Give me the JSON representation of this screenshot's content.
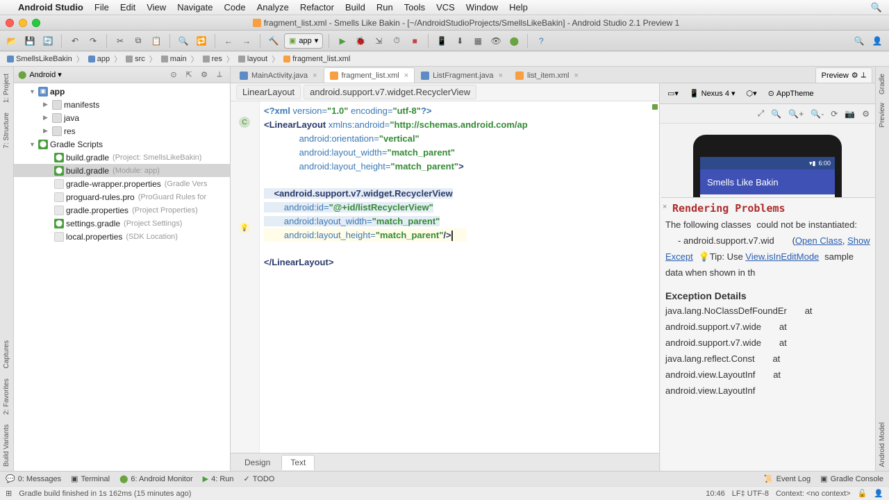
{
  "menubar": {
    "app": "Android Studio",
    "items": [
      "File",
      "Edit",
      "View",
      "Navigate",
      "Code",
      "Analyze",
      "Refactor",
      "Build",
      "Run",
      "Tools",
      "VCS",
      "Window",
      "Help"
    ]
  },
  "window_title": "fragment_list.xml - Smells Like Bakin - [~/AndroidStudioProjects/SmellsLikeBakin] - Android Studio 2.1 Preview 1",
  "breadcrumbs": [
    "SmellsLikeBakin",
    "app",
    "src",
    "main",
    "res",
    "layout",
    "fragment_list.xml"
  ],
  "run_config": "app",
  "project": {
    "view": "Android",
    "app": "app",
    "folders": [
      "manifests",
      "java",
      "res"
    ],
    "gradle_scripts": "Gradle Scripts",
    "items": [
      {
        "n": "build.gradle",
        "h": "(Project: SmellsLikeBakin)"
      },
      {
        "n": "build.gradle",
        "h": "(Module: app)",
        "sel": true
      },
      {
        "n": "gradle-wrapper.properties",
        "h": "(Gradle Vers"
      },
      {
        "n": "proguard-rules.pro",
        "h": "(ProGuard Rules for"
      },
      {
        "n": "gradle.properties",
        "h": "(Project Properties)"
      },
      {
        "n": "settings.gradle",
        "h": "(Project Settings)"
      },
      {
        "n": "local.properties",
        "h": "(SDK Location)"
      }
    ]
  },
  "tabs": [
    {
      "n": "MainActivity.java",
      "t": "java"
    },
    {
      "n": "fragment_list.xml",
      "t": "xml",
      "active": true
    },
    {
      "n": "ListFragment.java",
      "t": "java"
    },
    {
      "n": "list_item.xml",
      "t": "xml"
    }
  ],
  "preview_tab": "Preview",
  "bread_nav": [
    "LinearLayout",
    "android.support.v7.widget.RecyclerView"
  ],
  "code": {
    "l1a": "<?xml ",
    "l1b": "version=",
    "l1c": "\"1.0\"",
    "l1d": " encoding=",
    "l1e": "\"utf-8\"",
    "l1f": "?>",
    "l2a": "<LinearLayout ",
    "l2b": "xmlns:android=",
    "l2c": "\"http://schemas.android.com/ap",
    "l3a": "              android:orientation=",
    "l3b": "\"vertical\"",
    "l4a": "              android:layout_width=",
    "l4b": "\"match_parent\"",
    "l5a": "              android:layout_height=",
    "l5b": "\"match_parent\"",
    "l5c": ">",
    "l7a": "    <android.support.v7.widget.RecyclerView",
    "l8a": "        android:id=",
    "l8b": "\"@+id/listRecyclerView\"",
    "l9a": "        android:layout_width=",
    "l9b": "\"match_parent\"",
    "l10a": "        android:layout_height=",
    "l10b": "\"match_parent\"",
    "l10c": "/>",
    "l12": "</LinearLayout>"
  },
  "design_tabs": {
    "design": "Design",
    "text": "Text"
  },
  "preview": {
    "device": "Nexus 4",
    "theme": "AppTheme",
    "clock": "6:00",
    "app_title": "Smells Like Bakin"
  },
  "render_err": {
    "title": "Rendering Problems",
    "msg1": "The following classes",
    "msg2": "could not be instantiated:",
    "cls": "- android.support.v7.wid",
    "open": "Open Class",
    "show": "Show Except",
    "tip": "Tip: Use ",
    "tip_link": "View.isInEditMode",
    "tip2": "sample data when shown in th",
    "exh": "Exception Details",
    "ex1": "java.lang.NoClassDefFoundEr",
    "ex2": "at android.support.v7.wide",
    "ex3": "at android.support.v7.wide",
    "ex4": "at java.lang.reflect.Const",
    "ex5": "at android.view.LayoutInf",
    "ex6": "at android.view.LayoutInf"
  },
  "bottom": {
    "messages": "0: Messages",
    "terminal": "Terminal",
    "monitor": "6: Android Monitor",
    "run": "4: Run",
    "todo": "TODO",
    "event": "Event Log",
    "gradle": "Gradle Console"
  },
  "status": {
    "msg": "Gradle build finished in 1s 162ms (15 minutes ago)",
    "pos": "10:46",
    "enc": "LF‡   UTF-8",
    "ctx": "Context: <no context>"
  },
  "edge": {
    "project": "1: Project",
    "structure": "7: Structure",
    "captures": "Captures",
    "favorites": "2: Favorites",
    "variants": "Build Variants",
    "gradle_r": "Gradle",
    "preview_r": "Preview",
    "model_r": "Android Model"
  }
}
